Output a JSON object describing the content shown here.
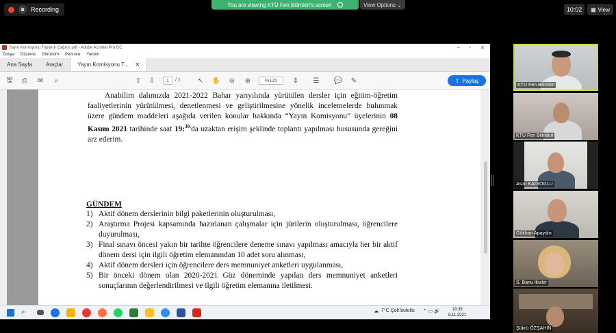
{
  "zoom_top": {
    "recording_label": "Recording",
    "viewing_banner": "You are viewing KTÜ Fen Bilimleri's screen",
    "view_options_label": "View Options",
    "time": "10:02",
    "view_label": "View"
  },
  "acrobat": {
    "window_title": "Yayın Komisyonu Toplantı Çağrısı.pdf - Adobe Acrobat Pro DC",
    "menus": [
      "Dosya",
      "Düzenle",
      "Görünüm",
      "Pencere",
      "Yardım"
    ],
    "tabs": [
      "Ana Sayfa",
      "Araçlar",
      "Yayın Komisyonu T..."
    ],
    "page_current": "1",
    "page_total": "/ 1",
    "zoom": "%125",
    "share_label": "Paylaş"
  },
  "document": {
    "para_a": "Anabilim dalımızda 2021-2022 Bahar yarıyılında yürütülen dersler için eğitim-öğretim faaliyetlerinin yürütülmesi, denetlenmesi ve geliştirilmesine yönelik incelemelerde bulunmak üzere gündem maddeleri aşağıda verilen konular hakkında “Yayın Komisyonu” üyelerinin ",
    "para_date": "08 Kasım 2021",
    "para_b": " tarihinde saat ",
    "para_time": "19:",
    "para_time_sup": "30",
    "para_c": "'da uzaktan erişim şeklinde toplantı yapılması hususunda gereğini arz ederim.",
    "heading": "GÜNDEM",
    "items": [
      {
        "num": "1)",
        "text": "Aktif dönem derslerinin bilgi paketlerinin oluşturulması,"
      },
      {
        "num": "2)",
        "text": "Araştırma Projesi kapsamında hazırlanan çalışmalar için jürilerin oluşturulması, öğrencilere duyurulması,"
      },
      {
        "num": "3)",
        "text": "Final sınavı öncesi yakın bir tarihte öğrencilere deneme sınavı yapılması amacıyla her bir aktif dönem dersi için ilgili öğretim elemanından 10 adet soru alınması,"
      },
      {
        "num": "4)",
        "text": "Aktif dönem dersleri için öğrencilere ders memnuniyet anketleri uygulanması,"
      },
      {
        "num": "5)",
        "text": "Bir önceki dönem olan 2020-2021 Güz döneminde yapılan ders memnuniyet anketleri sonuçlarının değerlendirilmesi ve ilgili öğretim elemanına iletilmesi."
      }
    ]
  },
  "taskbar": {
    "weather": "7°C  Çok bulutlu",
    "time": "19:35",
    "date": "8.11.2021",
    "app_colors": [
      "#1a73e8",
      "#f4b400",
      "#e53935",
      "#ff7043",
      "#25d366",
      "#2e7d32",
      "#fbc02d",
      "#2d8cff",
      "#2b579a",
      "#d9261c"
    ]
  },
  "participants": [
    {
      "name": "KTÜ Fen Bilimleri",
      "speaking": true
    },
    {
      "name": "KTÜ Fen Bilimleri",
      "speaking": false
    },
    {
      "name": "Asim KADIOGLU",
      "speaking": false
    },
    {
      "name": "Gökhan Apaydın",
      "speaking": false
    },
    {
      "name": "S. Banu İkizler",
      "speaking": false
    },
    {
      "name": "Şükrü ÖZŞAHİN",
      "speaking": false
    }
  ]
}
